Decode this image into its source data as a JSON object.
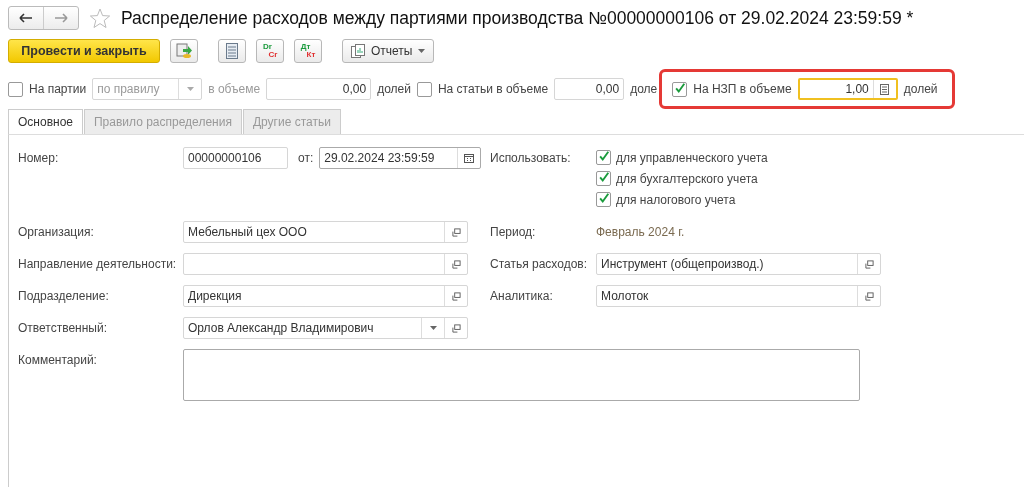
{
  "title": "Распределение расходов между партиями производства №00000000106 от 29.02.2024 23:59:59 *",
  "toolbar": {
    "primary": "Провести и закрыть",
    "icon_buttons": [
      {
        "kind": "post-doc"
      },
      {
        "kind": "list"
      },
      {
        "kind": "dr-cr",
        "top": "Dr",
        "bottom": "Cr"
      },
      {
        "kind": "dr-cr",
        "top": "Дт",
        "bottom": "Кт"
      }
    ],
    "reports": "Отчеты"
  },
  "distribution": [
    {
      "kind": "batches",
      "label": "На партии",
      "checked": false,
      "rule": "по правилу",
      "volume_label": "в объеме",
      "value": "0,00",
      "unit": "долей"
    },
    {
      "kind": "articles",
      "label": "На статьи в объеме",
      "checked": false,
      "value": "0,00",
      "unit": "доле"
    },
    {
      "kind": "wip",
      "label": "На НЗП в объеме",
      "checked": true,
      "value": "1,00",
      "unit": "долей",
      "highlighted": true
    }
  ],
  "tabs": [
    {
      "label": "Основное",
      "selected": true
    },
    {
      "label": "Правило распределения",
      "selected": false
    },
    {
      "label": "Другие статьи",
      "selected": false
    }
  ],
  "number": {
    "label": "Номер:",
    "value": "00000000106",
    "date_label": "от:",
    "date": "29.02.2024 23:59:59"
  },
  "use": {
    "label": "Использовать:",
    "options": [
      {
        "label": "для управленческого учета",
        "checked": true
      },
      {
        "label": "для бухгалтерского учета",
        "checked": true
      },
      {
        "label": "для налогового учета",
        "checked": true
      }
    ]
  },
  "rows": [
    {
      "left": {
        "label": "Организация:",
        "value": "Мебельный цех ООО",
        "kind": "open"
      },
      "right": {
        "kind": "text",
        "label": "Период:",
        "value": "Февраль 2024 г."
      }
    },
    {
      "left": {
        "label": "Направление деятельности:",
        "kind": "open"
      },
      "right": {
        "kind": "open",
        "label": "Статья расходов:",
        "value": "Инструмент (общепроизвод.)"
      }
    },
    {
      "left": {
        "label": "Подразделение:",
        "value": "Дирекция",
        "kind": "open"
      },
      "right": {
        "kind": "open",
        "label": "Аналитика:",
        "value": "Молоток"
      }
    },
    {
      "left": {
        "label": "Ответственный:",
        "value": "Орлов Александр Владимирович",
        "kind": "select-open"
      }
    }
  ],
  "comment": {
    "label": "Комментарий:"
  }
}
